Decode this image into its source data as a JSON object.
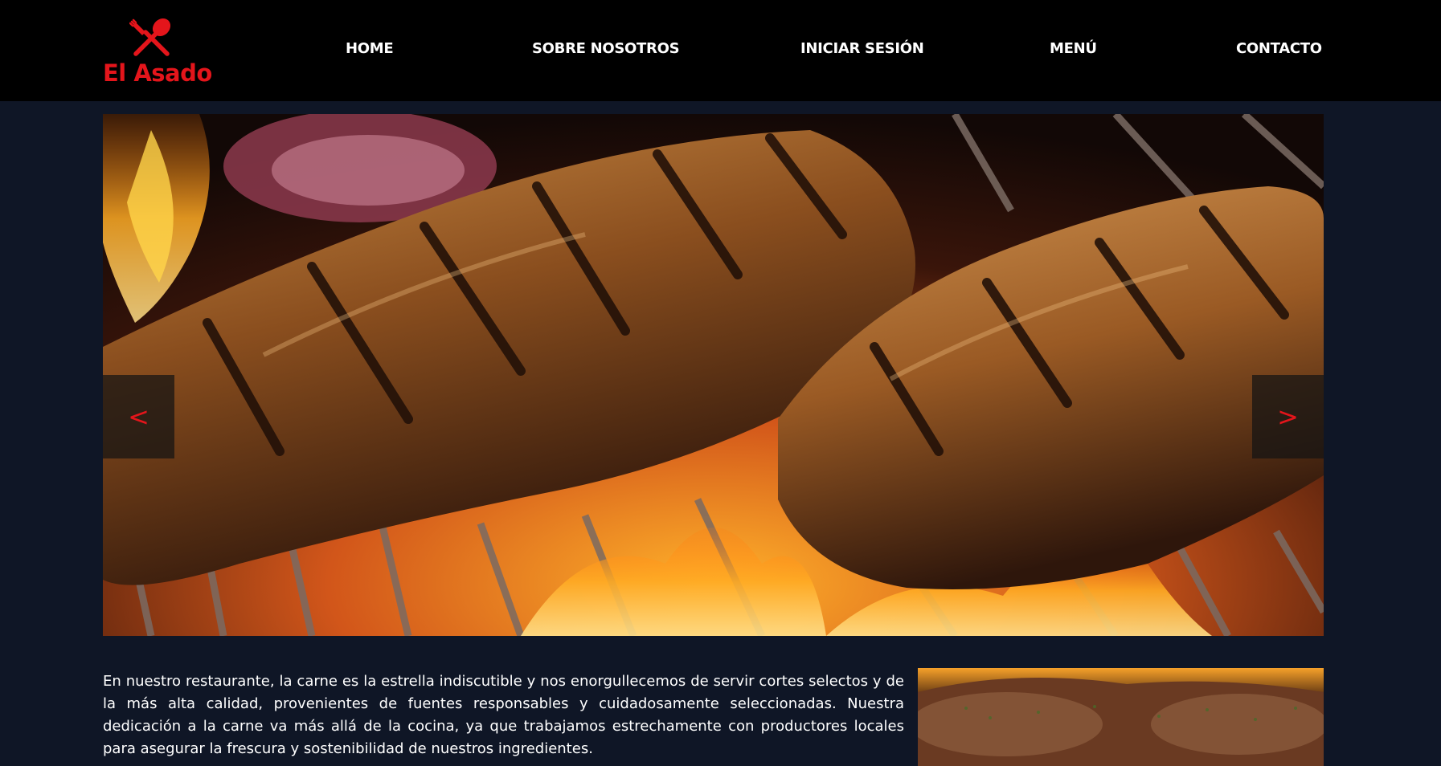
{
  "brand": {
    "name": "El Asado",
    "color": "#e4151b",
    "icon": "fork-spoon-icon"
  },
  "nav": {
    "home": "HOME",
    "about": "SOBRE NOSOTROS",
    "login": "INICIAR SESIÓN",
    "menu": "MENÚ",
    "contact": "CONTACTO"
  },
  "carousel": {
    "image": "grilled-steaks-photo",
    "prev_label": "<",
    "next_label": ">",
    "control_color": "#e4151b"
  },
  "about": {
    "text": "En nuestro restaurante, la carne es la estrella indiscutible y nos enorgullecemos de servir cortes selectos y de la más alta calidad, provenientes de fuentes responsables y cuidadosamente seleccionadas. Nuestra dedicación a la carne va más allá de la cocina, ya que trabajamos estrechamente con productores locales para asegurar la frescura y sostenibilidad de nuestros ingredientes.",
    "image": "grilled-meat-photo"
  },
  "colors": {
    "background": "#0f1626",
    "navbar": "#000000",
    "text": "#ffffff"
  }
}
